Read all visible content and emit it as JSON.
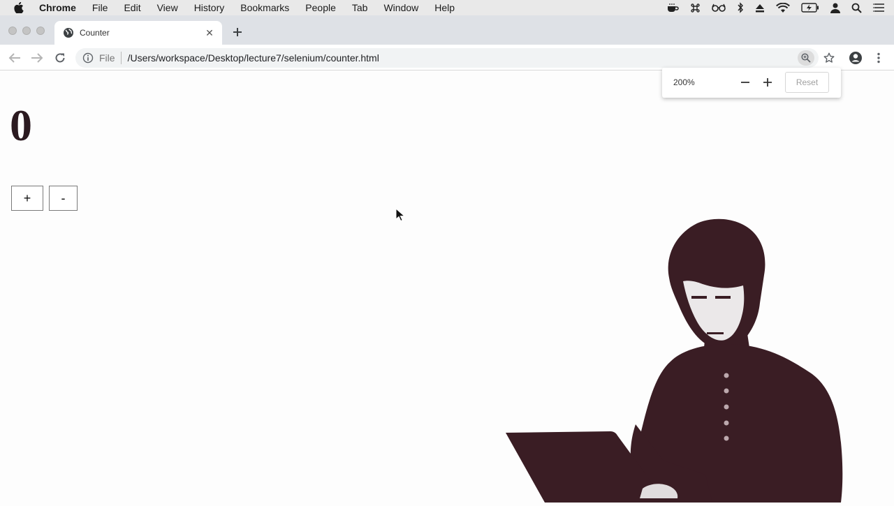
{
  "menubar": {
    "app_name": "Chrome",
    "items": [
      "File",
      "Edit",
      "View",
      "History",
      "Bookmarks",
      "People",
      "Tab",
      "Window",
      "Help"
    ]
  },
  "tab": {
    "title": "Counter",
    "close_glyph": "✕",
    "new_tab_icon": "plus-icon"
  },
  "toolbar": {
    "file_label": "File",
    "url": "/Users/workspace/Desktop/lecture7/selenium/counter.html"
  },
  "zoom_bubble": {
    "level": "200%",
    "reset_label": "Reset"
  },
  "page": {
    "counter_value": "0",
    "increment_label": "+",
    "decrement_label": "-"
  },
  "colors": {
    "menubar_bg": "#e9e9e9",
    "tabstrip_bg": "#dee1e6",
    "silhouette": "#3a1d24"
  }
}
